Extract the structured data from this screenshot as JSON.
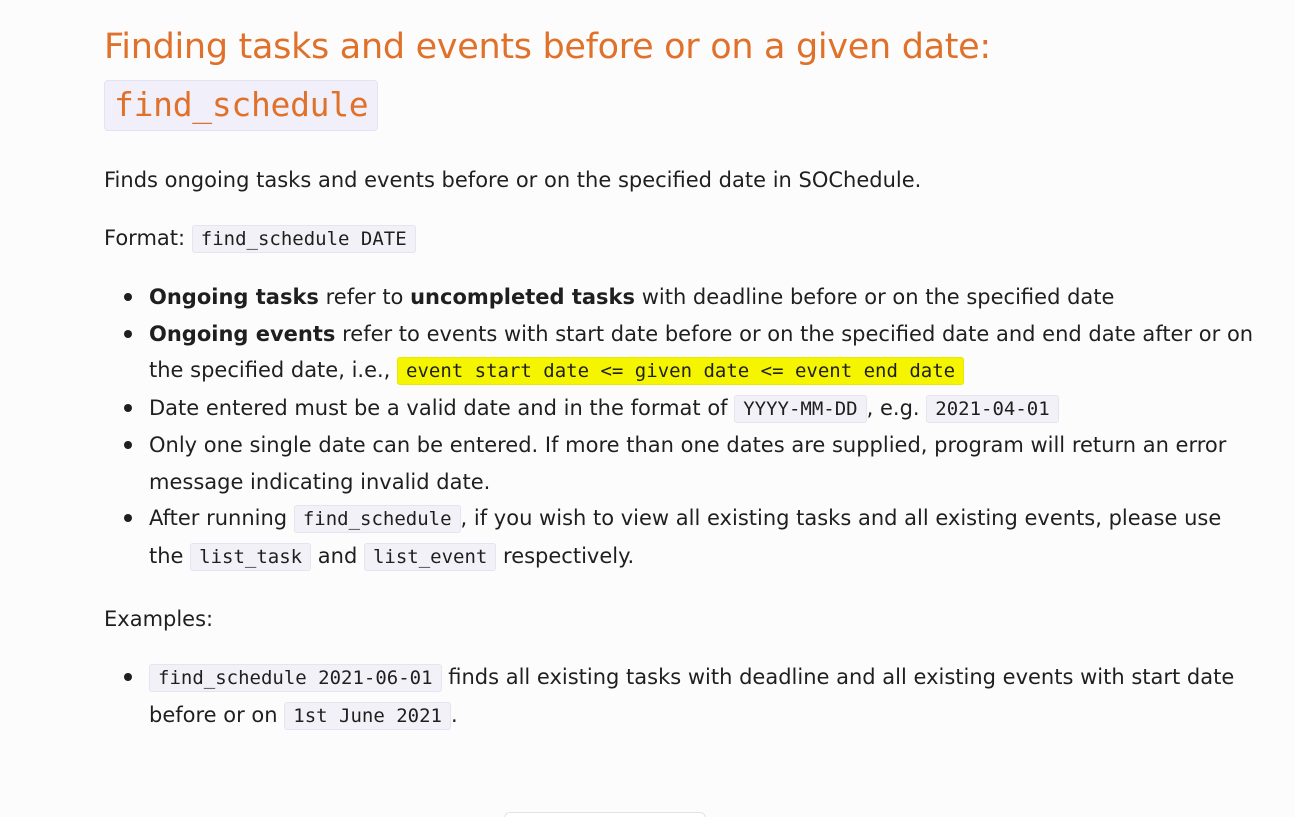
{
  "heading": {
    "text": "Finding tasks and events before or on a given date:",
    "code": "find_schedule"
  },
  "description": "Finds ongoing tasks and events before or on the specified date in SOChedule.",
  "format": {
    "label": "Format:",
    "code": "find_schedule DATE"
  },
  "rules": {
    "r1": {
      "b1": "Ongoing tasks",
      "t1": " refer to ",
      "b2": "uncompleted tasks",
      "t2": " with deadline before or on the specified date"
    },
    "r2": {
      "b1": "Ongoing events",
      "t1": " refer to events with start date before or on the specified date and end date after or on the specified date, i.e., ",
      "code": "event start date <= given date <= event end date"
    },
    "r3": {
      "t1": "Date entered must be a valid date and in the format of ",
      "code1": "YYYY-MM-DD",
      "t2": ", e.g. ",
      "code2": "2021-04-01"
    },
    "r4": {
      "t1": "Only one single date can be entered. If more than one dates are supplied, program will return an error message indicating invalid date."
    },
    "r5": {
      "t1": "After running ",
      "code1": "find_schedule",
      "t2": ", if you wish to view all existing tasks and all existing events, please use the ",
      "code2": "list_task",
      "t3": " and ",
      "code3": "list_event",
      "t4": " respectively."
    }
  },
  "examples": {
    "label": "Examples:",
    "e1": {
      "code1": "find_schedule 2021-06-01",
      "t1": " finds all existing tasks with deadline and all existing events with start date before or on ",
      "code2": "1st June 2021",
      "t2": "."
    }
  },
  "colors": {
    "heading": "#e0712a",
    "highlight": "#f5f500",
    "code_bg": "#f2f1f8"
  }
}
